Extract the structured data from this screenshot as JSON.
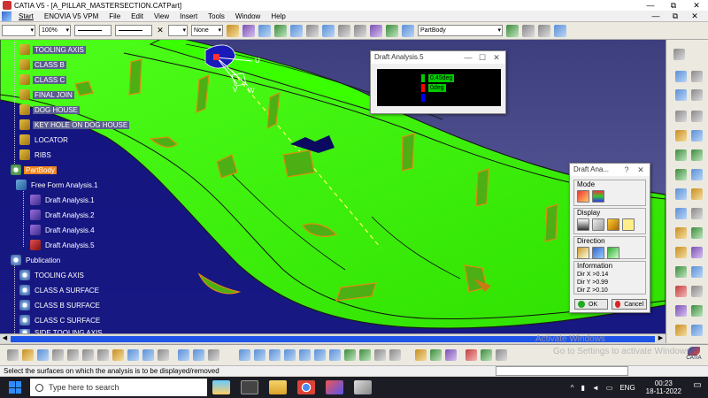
{
  "window": {
    "title": "CATIA V5 - [A_PILLAR_MASTERSECTION.CATPart]",
    "minimize": "—",
    "maximize": "⧉",
    "close": "✕"
  },
  "menu": {
    "items": [
      "Start",
      "ENOVIA V5 VPM",
      "File",
      "Edit",
      "View",
      "Insert",
      "Tools",
      "Window",
      "Help"
    ],
    "doc_minimize": "—",
    "doc_restore": "⧉",
    "doc_close": "✕"
  },
  "toolbar": {
    "zoom_combo": "100%",
    "layer_combo": "None",
    "current_body": "PartBody",
    "close_glyph": "✕"
  },
  "tree": {
    "items": [
      {
        "label": "TOOLING AXIS",
        "highlighted": true
      },
      {
        "label": "CLASS B",
        "highlighted": true
      },
      {
        "label": "CLASS C",
        "highlighted": true
      },
      {
        "label": "FINAL JOIN",
        "highlighted": true
      },
      {
        "label": "DOG HOUSE",
        "highlighted": true
      },
      {
        "label": "KEY HOLE ON DOG HOUSE",
        "highlighted": true
      },
      {
        "label": "LOCATOR",
        "highlighted": false
      },
      {
        "label": "RIBS",
        "highlighted": false
      },
      {
        "label": "PartBody",
        "selected": true
      },
      {
        "label": "Free Form Analysis.1"
      },
      {
        "label": "Draft Analysis.1"
      },
      {
        "label": "Draft Analysis.2"
      },
      {
        "label": "Draft Analysis.4"
      },
      {
        "label": "Draft Analysis.5"
      },
      {
        "label": "Publication"
      },
      {
        "label": "TOOLING AXIS"
      },
      {
        "label": "CLASS A SURFACE"
      },
      {
        "label": "CLASS B SURFACE"
      },
      {
        "label": "CLASS C SURFACE"
      },
      {
        "label": "SIDE TOOLING AXIS"
      }
    ]
  },
  "compass": {
    "u": "U",
    "v": "V",
    "w": "W"
  },
  "legend_window": {
    "title": "Draft Analysis.5",
    "rows": [
      {
        "label": "0.45deg",
        "color": "#00cc00"
      },
      {
        "label": "0deg",
        "color": "#ff0000"
      },
      {
        "label": "",
        "color": "#0000ff"
      }
    ],
    "minimize": "—",
    "maximize": "☐",
    "close": "✕"
  },
  "options_dialog": {
    "title": "Draft Ana...",
    "help": "?",
    "close": "✕",
    "mode_label": "Mode",
    "display_label": "Display",
    "direction_label": "Direction",
    "information_label": "Information",
    "dir_x": "Dir X >0.14",
    "dir_y": "Dir Y >0.99",
    "dir_z": "Dir Z >0.10",
    "ok_label": "OK",
    "cancel_label": "Cancel"
  },
  "status": {
    "message": "Select the surfaces on which the analysis is to be displayed/removed"
  },
  "watermark": {
    "line1": "Activate Windows",
    "line2": "Go to Settings to activate Windows."
  },
  "logo": {
    "text": "CATIA"
  },
  "taskbar": {
    "search_placeholder": "Type here to search",
    "language": "ENG",
    "time": "00:23",
    "date": "18-11-2022",
    "tray_caret": "^",
    "notify_glyph": "▭"
  },
  "colors": {
    "surface": "#33ff00",
    "surface_edge": "#1a1a1a",
    "fin": "#4caf14",
    "fin_edge": "#e08a10",
    "background_top": "#3d3e7e",
    "selection": "#f0841e",
    "scroll_thumb": "#1f55e6"
  }
}
